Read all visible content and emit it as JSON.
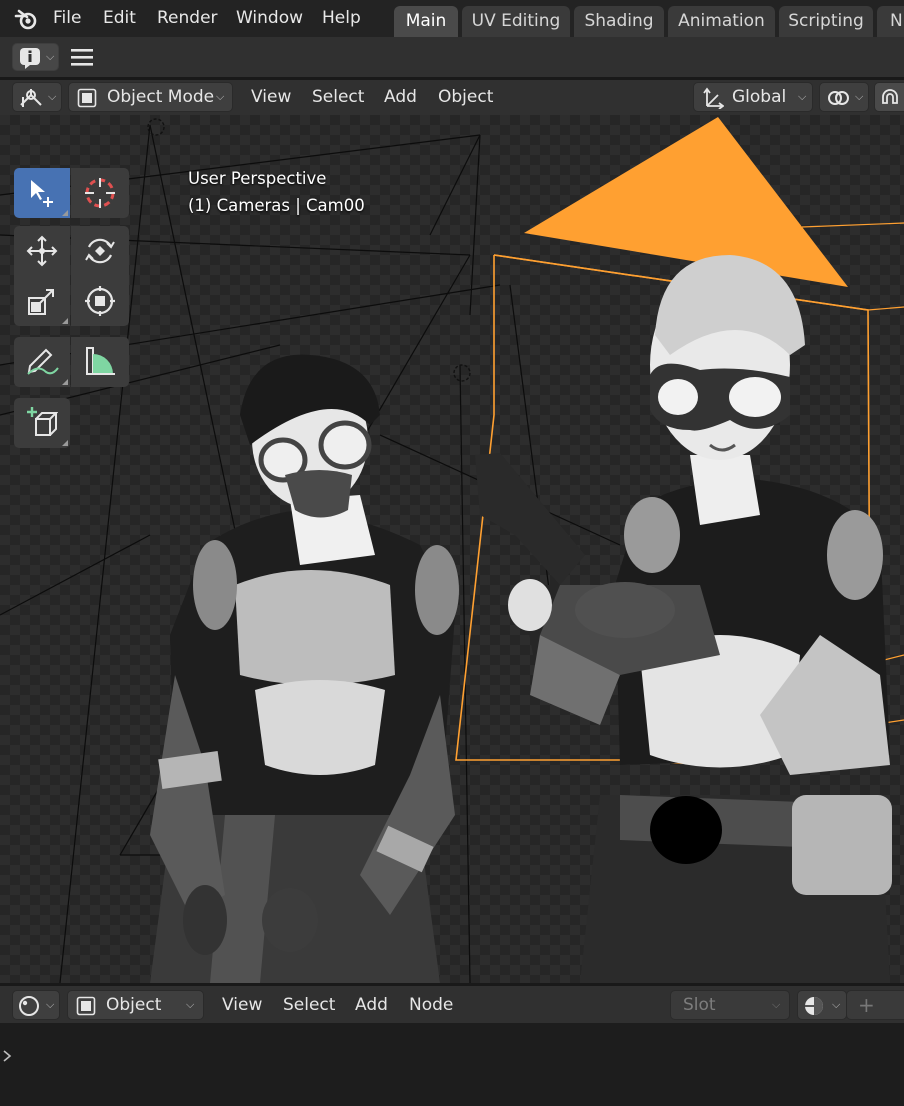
{
  "topbar": {
    "menus": [
      "File",
      "Edit",
      "Render",
      "Window",
      "Help"
    ],
    "workspace_tabs": [
      "Main",
      "UV Editing",
      "Shading",
      "Animation",
      "Scripting",
      "N"
    ],
    "active_tab": "Main"
  },
  "view_header": {
    "mode": "Object Mode",
    "menus": [
      "View",
      "Select",
      "Add",
      "Object"
    ],
    "transform_orientation": "Global"
  },
  "viewport": {
    "perspective_label": "User Perspective",
    "collection_label": "(1) Cameras | Cam00",
    "active_tool": "select-box",
    "accent_color": "#ffa031"
  },
  "bottom_header": {
    "mode": "Object",
    "menus": [
      "View",
      "Select",
      "Add",
      "Node"
    ],
    "slot_placeholder": "Slot",
    "new_label": "+"
  }
}
